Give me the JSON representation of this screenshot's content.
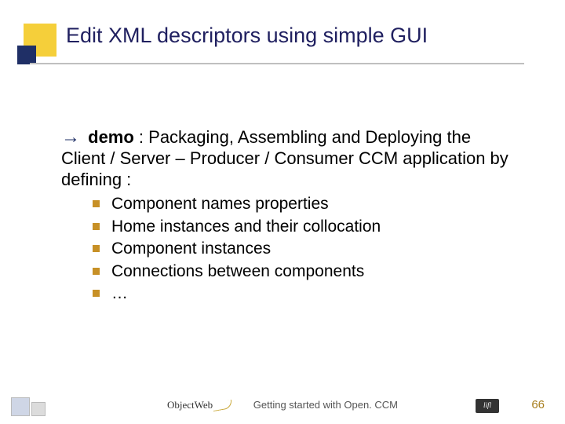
{
  "title": "Edit XML descriptors using simple GUI",
  "body": {
    "arrow": "→",
    "demo_label": "demo",
    "demo_text": " : Packaging, Assembling and Deploying the Client / Server – Producer / Consumer CCM application by defining :",
    "items": [
      "Component names properties",
      "Home instances and their collocation",
      "Component instances",
      "Connections between components",
      "…"
    ]
  },
  "footer": {
    "center_logo_text": "ObjectWeb",
    "caption": "Getting started with Open. CCM",
    "right_logo_text": "lifl",
    "page": "66"
  }
}
